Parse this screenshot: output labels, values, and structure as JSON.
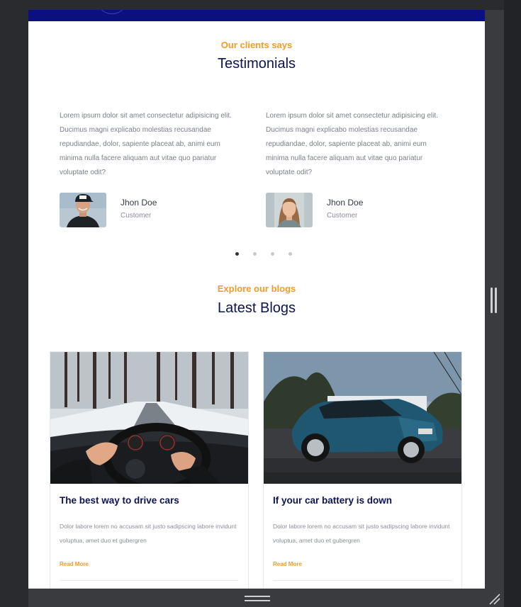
{
  "testimonials": {
    "subtitle": "Our clients says",
    "title": "Testimonials",
    "items": [
      {
        "text": "Lorem ipsum dolor sit amet consectetur adipisicing elit. Ducimus magni explicabo molestias recusandae repudiandae, dolor, sapiente placeat ab, animi eum minima nulla facere aliquam aut vitae quo pariatur voluptate odit?",
        "name": "Jhon Doe",
        "role": "Customer",
        "avatar_icon": "man-in-cap-photo"
      },
      {
        "text": "Lorem ipsum dolor sit amet consectetur adipisicing elit. Ducimus magni explicabo molestias recusandae repudiandae, dolor, sapiente placeat ab, animi eum minima nulla facere aliquam aut vitae quo pariatur voluptate odit?",
        "name": "Jhon Doe",
        "role": "Customer",
        "avatar_icon": "woman-portrait-photo"
      }
    ],
    "carousel": {
      "pages": 4,
      "active": 1
    }
  },
  "blogs": {
    "subtitle": "Explore our blogs",
    "title": "Latest Blogs",
    "posts": [
      {
        "title": "The best way to drive cars",
        "excerpt": "Dolor labore lorem no accusam sit justo sadipscing labore invidunt voluptua, amet duo et gubergren",
        "link": "Read More",
        "image_icon": "steering-wheel-snow-road-photo"
      },
      {
        "title": "If your car battery is down",
        "excerpt": "Dolor labore lorem no accusam sit justo sadipscing labore invidunt voluptua, amet duo et gubergren",
        "link": "Read More",
        "image_icon": "blue-hatchback-car-photo"
      }
    ]
  },
  "colors": {
    "accent": "#f29b2b",
    "heading": "#0b1450",
    "hero": "#0a1080",
    "chrome": "#2a2b2e"
  }
}
